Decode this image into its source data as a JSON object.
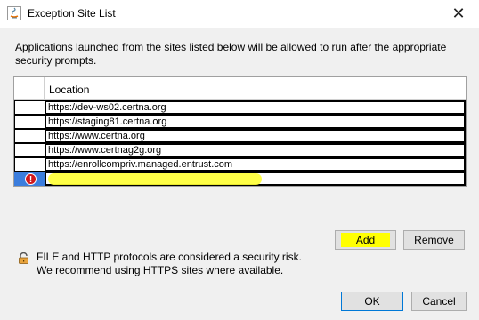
{
  "window": {
    "title": "Exception Site List"
  },
  "description": "Applications launched from the sites listed below will be allowed to run after the appropriate security prompts.",
  "table": {
    "column_header": "Location",
    "rows": [
      "https://dev-ws02.certna.org",
      "https://staging81.certna.org",
      "https://www.certna.org",
      "https://www.certnag2g.org",
      "https://enrollcompriv.managed.entrust.com",
      ""
    ]
  },
  "buttons": {
    "add": "Add",
    "remove": "Remove",
    "ok": "OK",
    "cancel": "Cancel"
  },
  "warning": {
    "line1": "FILE and HTTP protocols are considered a security risk.",
    "line2": "We recommend using HTTPS sites where available."
  },
  "icons": {
    "app": "java-icon",
    "close": "close-icon",
    "error": "error-icon",
    "lock": "lock-icon"
  },
  "colors": {
    "selection": "#3b7ddd",
    "error": "#d0181d",
    "highlight": "#ffff00"
  }
}
